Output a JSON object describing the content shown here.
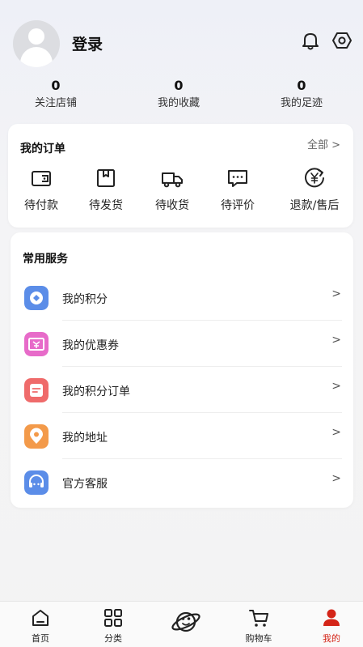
{
  "header": {
    "login_label": "登录",
    "icons": [
      "bell-icon",
      "settings-icon"
    ]
  },
  "stats": [
    {
      "value": "0",
      "label": "关注店铺"
    },
    {
      "value": "0",
      "label": "我的收藏"
    },
    {
      "value": "0",
      "label": "我的足迹"
    }
  ],
  "orders": {
    "title": "我的订单",
    "all_label": "全部 >",
    "items": [
      {
        "label": "待付款",
        "icon": "wallet-icon"
      },
      {
        "label": "待发货",
        "icon": "box-icon"
      },
      {
        "label": "待收货",
        "icon": "truck-icon"
      },
      {
        "label": "待评价",
        "icon": "comment-icon"
      },
      {
        "label": "退款/售后",
        "icon": "refund-icon"
      }
    ]
  },
  "services": {
    "title": "常用服务",
    "items": [
      {
        "label": "我的积分",
        "icon": "points-icon",
        "color": "#5b8de8"
      },
      {
        "label": "我的优惠券",
        "icon": "coupon-icon",
        "color": "#e76bc9"
      },
      {
        "label": "我的积分订单",
        "icon": "points-order-icon",
        "color": "#ef6b6b"
      },
      {
        "label": "我的地址",
        "icon": "location-icon",
        "color": "#f39a4a"
      },
      {
        "label": "官方客服",
        "icon": "customer-service-icon",
        "color": "#5b8de8"
      }
    ],
    "chevron": ">"
  },
  "tabbar": {
    "items": [
      {
        "label": "首页",
        "icon": "home-icon"
      },
      {
        "label": "分类",
        "icon": "category-icon"
      },
      {
        "label": "",
        "icon": "planet-icon"
      },
      {
        "label": "购物车",
        "icon": "cart-icon"
      },
      {
        "label": "我的",
        "icon": "profile-icon"
      }
    ],
    "active_color": "#d42518"
  }
}
